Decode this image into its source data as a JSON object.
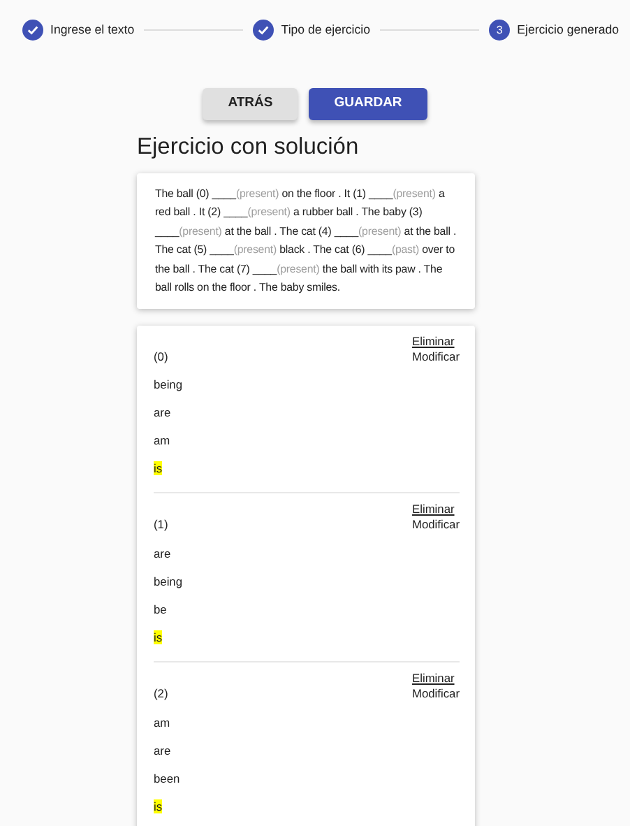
{
  "stepper": [
    {
      "label": "Ingrese el texto",
      "done": true
    },
    {
      "label": "Tipo de ejercicio",
      "done": true
    },
    {
      "label": "Ejercicio generado",
      "done": false,
      "number": "3"
    }
  ],
  "buttons": [
    {
      "label": "ATRÁS",
      "kind": "secondary"
    },
    {
      "label": "GUARDAR",
      "kind": "primary"
    }
  ],
  "heading": "Ejercicio con solución",
  "exercise_text": [
    {
      "kind": "text",
      "text": "The ball (0) ____"
    },
    {
      "kind": "hint",
      "text": "(present)"
    },
    {
      "kind": "text",
      "text": " on the floor . It (1) ____"
    },
    {
      "kind": "hint",
      "text": "(present)"
    },
    {
      "kind": "text",
      "text": " a red ball . It (2) ____"
    },
    {
      "kind": "hint",
      "text": "(present)"
    },
    {
      "kind": "text",
      "text": " a rubber ball . The baby (3) ____"
    },
    {
      "kind": "hint",
      "text": "(present)"
    },
    {
      "kind": "text",
      "text": " at the ball . The cat (4) ____"
    },
    {
      "kind": "hint",
      "text": "(present)"
    },
    {
      "kind": "text",
      "text": " at the ball . The cat (5) ____"
    },
    {
      "kind": "hint",
      "text": "(present)"
    },
    {
      "kind": "text",
      "text": " black . The cat (6) ____"
    },
    {
      "kind": "hint",
      "text": "(past)"
    },
    {
      "kind": "text",
      "text": " over to the ball . The cat (7) ____"
    },
    {
      "kind": "hint",
      "text": "(present)"
    },
    {
      "kind": "text",
      "text": " the ball with its paw . The ball rolls on the floor . The baby smiles."
    }
  ],
  "questions": [
    {
      "number": "(0)",
      "delete": "Eliminar",
      "edit": "Modificar",
      "options": [
        {
          "text": "being",
          "correct": false
        },
        {
          "text": "are",
          "correct": false
        },
        {
          "text": "am",
          "correct": false
        },
        {
          "text": "is",
          "correct": true
        }
      ]
    },
    {
      "number": "(1)",
      "delete": "Eliminar",
      "edit": "Modificar",
      "options": [
        {
          "text": "are",
          "correct": false
        },
        {
          "text": "being",
          "correct": false
        },
        {
          "text": "be",
          "correct": false
        },
        {
          "text": "is",
          "correct": true
        }
      ]
    },
    {
      "number": "(2)",
      "delete": "Eliminar",
      "edit": "Modificar",
      "options": [
        {
          "text": "am",
          "correct": false
        },
        {
          "text": "are",
          "correct": false
        },
        {
          "text": "been",
          "correct": false
        },
        {
          "text": "is",
          "correct": true
        }
      ]
    }
  ]
}
